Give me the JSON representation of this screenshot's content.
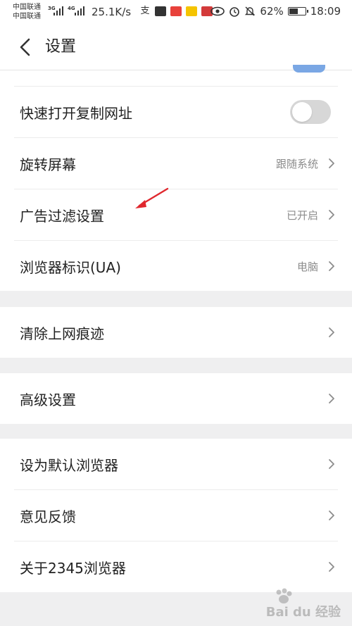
{
  "status_bar": {
    "carrier_1": "中国联通",
    "carrier_2": "中国联通",
    "net_1": "3G",
    "net_2": "4G",
    "speed": "25.1K/s",
    "battery": "62%",
    "battery_level": 0.62,
    "time": "18:09"
  },
  "app_bar": {
    "title": "设置"
  },
  "settings": {
    "quick_copy_url": {
      "label": "快速打开复制网址",
      "enabled": false
    },
    "rotate_screen": {
      "label": "旋转屏幕",
      "value": "跟随系统"
    },
    "ad_filter": {
      "label": "广告过滤设置",
      "value": "已开启"
    },
    "ua": {
      "label": "浏览器标识(UA)",
      "value": "电脑"
    },
    "clear_history": {
      "label": "清除上网痕迹"
    },
    "advanced": {
      "label": "高级设置"
    },
    "default_browser": {
      "label": "设为默认浏览器"
    },
    "feedback": {
      "label": "意见反馈"
    },
    "about": {
      "label": "关于2345浏览器"
    }
  },
  "watermark": {
    "text": "Bai du 经验"
  },
  "colors": {
    "toggle_on": "#7aa7e4",
    "toggle_off": "#d7d7d7",
    "annotation_arrow": "#e0282e"
  }
}
